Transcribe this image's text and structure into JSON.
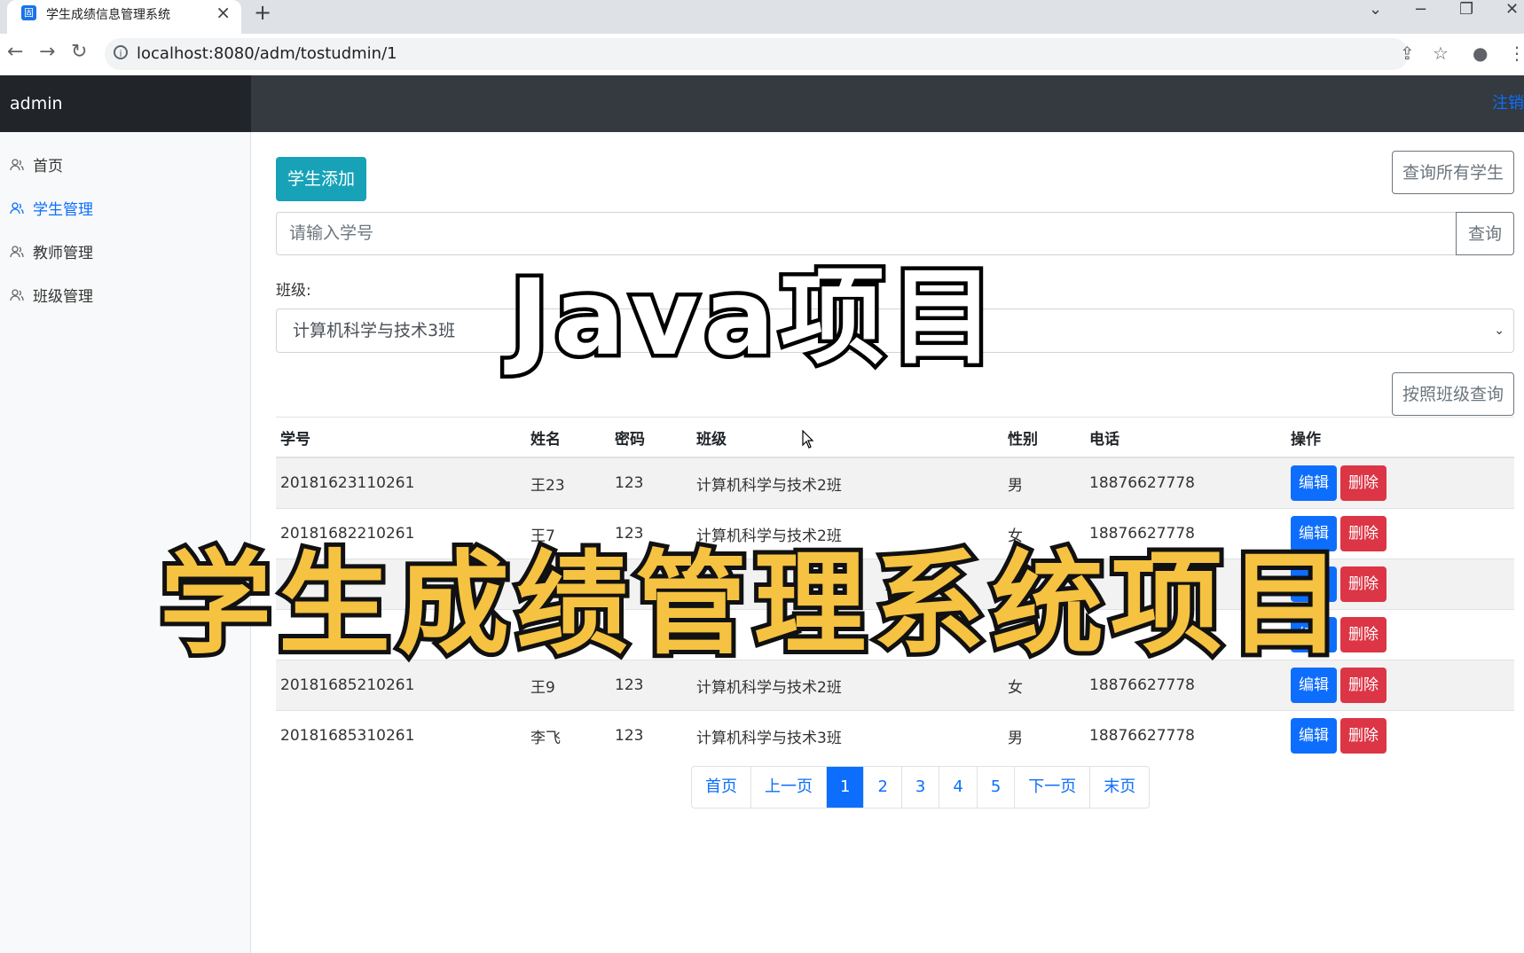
{
  "browser": {
    "tab_title": "学生成绩信息管理系统",
    "url": "localhost:8080/adm/tostudmin/1"
  },
  "app": {
    "brand": "admin",
    "logout": "注销"
  },
  "sidebar": {
    "items": [
      {
        "label": "首页",
        "active": false
      },
      {
        "label": "学生管理",
        "active": true
      },
      {
        "label": "教师管理",
        "active": false
      },
      {
        "label": "班级管理",
        "active": false
      }
    ]
  },
  "toolbar": {
    "add_label": "学生添加",
    "query_all_label": "查询所有学生",
    "search_placeholder": "请输入学号",
    "search_button": "查询",
    "class_label": "班级:",
    "class_selected": "计算机科学与技术3班",
    "query_by_class_label": "按照班级查询"
  },
  "table": {
    "headers": [
      "学号",
      "姓名",
      "密码",
      "班级",
      "性别",
      "电话",
      "操作"
    ],
    "rows": [
      [
        "20181623110261",
        "王23",
        "123",
        "计算机科学与技术2班",
        "男",
        "18876627778"
      ],
      [
        "20181682210261",
        "王7",
        "123",
        "计算机科学与技术2班",
        "女",
        "18876627778"
      ],
      [
        "",
        "",
        "",
        "",
        "男",
        ""
      ],
      [
        "",
        "",
        "",
        "",
        "男",
        ""
      ],
      [
        "20181685210261",
        "王9",
        "123",
        "计算机科学与技术2班",
        "女",
        "18876627778"
      ],
      [
        "20181685310261",
        "李飞",
        "123",
        "计算机科学与技术3班",
        "男",
        "18876627778"
      ]
    ],
    "edit_label": "编辑",
    "delete_label": "删除"
  },
  "pagination": {
    "first": "首页",
    "prev": "上一页",
    "pages": [
      "1",
      "2",
      "3",
      "4",
      "5"
    ],
    "current": "1",
    "next": "下一页",
    "last": "末页"
  },
  "overlay": {
    "line1": "Java项目",
    "line2": "学生成绩管理系统项目"
  }
}
